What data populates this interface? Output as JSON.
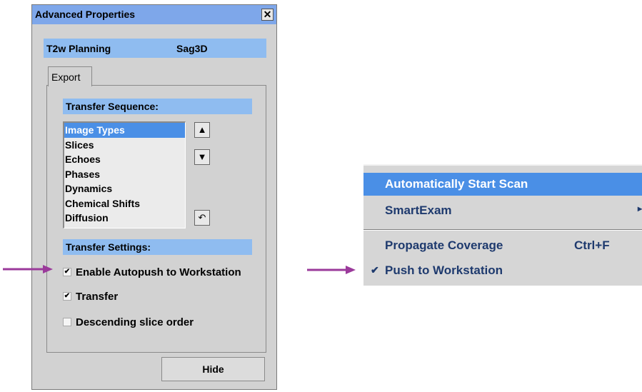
{
  "dialog": {
    "title": "Advanced Properties",
    "close_glyph": "✕",
    "header": {
      "left": "T2w Planning",
      "right": "Sag3D"
    },
    "tab_label": "Export",
    "transfer_sequence": {
      "heading": "Transfer Sequence:",
      "items": [
        {
          "label": "Image Types",
          "selected": true
        },
        {
          "label": "Slices",
          "selected": false
        },
        {
          "label": "Echoes",
          "selected": false
        },
        {
          "label": "Phases",
          "selected": false
        },
        {
          "label": "Dynamics",
          "selected": false
        },
        {
          "label": "Chemical Shifts",
          "selected": false
        },
        {
          "label": "Diffusion",
          "selected": false
        }
      ],
      "up_glyph": "▲",
      "down_glyph": "▼",
      "reset_glyph": "↶"
    },
    "transfer_settings": {
      "heading": "Transfer Settings:",
      "options": [
        {
          "label": "Enable Autopush to Workstation",
          "checked": true
        },
        {
          "label": "Transfer",
          "checked": true
        },
        {
          "label": "Descending slice order",
          "checked": false
        }
      ]
    },
    "hide_label": "Hide"
  },
  "menu": {
    "items": [
      {
        "label": "Automatically Start Scan",
        "highlighted": true
      },
      {
        "label": "SmartExam",
        "submenu_glyph": "▸"
      },
      {
        "label": "Propagate Coverage",
        "shortcut": "Ctrl+F"
      },
      {
        "label": "Push to Workstation",
        "check_glyph": "✔"
      }
    ]
  },
  "colors": {
    "title_bar": "#7ea7ea",
    "section_bar": "#8fbcf0",
    "selection": "#4a8fe6",
    "pointer_arrow": "#9b3a9b",
    "menu_text": "#1e3a6e"
  },
  "icons": {
    "pointer": "arrow-right-icon"
  }
}
